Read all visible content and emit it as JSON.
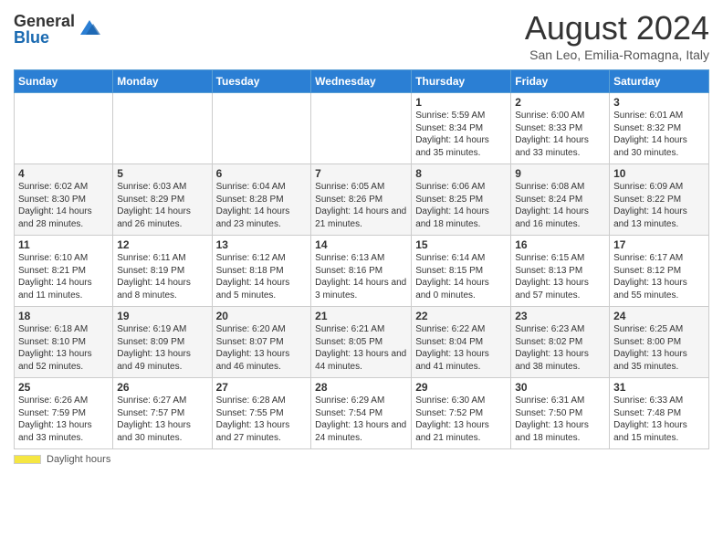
{
  "logo": {
    "general": "General",
    "blue": "Blue"
  },
  "header": {
    "title": "August 2024",
    "location": "San Leo, Emilia-Romagna, Italy"
  },
  "weekdays": [
    "Sunday",
    "Monday",
    "Tuesday",
    "Wednesday",
    "Thursday",
    "Friday",
    "Saturday"
  ],
  "weeks": [
    [
      {
        "day": "",
        "info": ""
      },
      {
        "day": "",
        "info": ""
      },
      {
        "day": "",
        "info": ""
      },
      {
        "day": "",
        "info": ""
      },
      {
        "day": "1",
        "info": "Sunrise: 5:59 AM\nSunset: 8:34 PM\nDaylight: 14 hours and 35 minutes."
      },
      {
        "day": "2",
        "info": "Sunrise: 6:00 AM\nSunset: 8:33 PM\nDaylight: 14 hours and 33 minutes."
      },
      {
        "day": "3",
        "info": "Sunrise: 6:01 AM\nSunset: 8:32 PM\nDaylight: 14 hours and 30 minutes."
      }
    ],
    [
      {
        "day": "4",
        "info": "Sunrise: 6:02 AM\nSunset: 8:30 PM\nDaylight: 14 hours and 28 minutes."
      },
      {
        "day": "5",
        "info": "Sunrise: 6:03 AM\nSunset: 8:29 PM\nDaylight: 14 hours and 26 minutes."
      },
      {
        "day": "6",
        "info": "Sunrise: 6:04 AM\nSunset: 8:28 PM\nDaylight: 14 hours and 23 minutes."
      },
      {
        "day": "7",
        "info": "Sunrise: 6:05 AM\nSunset: 8:26 PM\nDaylight: 14 hours and 21 minutes."
      },
      {
        "day": "8",
        "info": "Sunrise: 6:06 AM\nSunset: 8:25 PM\nDaylight: 14 hours and 18 minutes."
      },
      {
        "day": "9",
        "info": "Sunrise: 6:08 AM\nSunset: 8:24 PM\nDaylight: 14 hours and 16 minutes."
      },
      {
        "day": "10",
        "info": "Sunrise: 6:09 AM\nSunset: 8:22 PM\nDaylight: 14 hours and 13 minutes."
      }
    ],
    [
      {
        "day": "11",
        "info": "Sunrise: 6:10 AM\nSunset: 8:21 PM\nDaylight: 14 hours and 11 minutes."
      },
      {
        "day": "12",
        "info": "Sunrise: 6:11 AM\nSunset: 8:19 PM\nDaylight: 14 hours and 8 minutes."
      },
      {
        "day": "13",
        "info": "Sunrise: 6:12 AM\nSunset: 8:18 PM\nDaylight: 14 hours and 5 minutes."
      },
      {
        "day": "14",
        "info": "Sunrise: 6:13 AM\nSunset: 8:16 PM\nDaylight: 14 hours and 3 minutes."
      },
      {
        "day": "15",
        "info": "Sunrise: 6:14 AM\nSunset: 8:15 PM\nDaylight: 14 hours and 0 minutes."
      },
      {
        "day": "16",
        "info": "Sunrise: 6:15 AM\nSunset: 8:13 PM\nDaylight: 13 hours and 57 minutes."
      },
      {
        "day": "17",
        "info": "Sunrise: 6:17 AM\nSunset: 8:12 PM\nDaylight: 13 hours and 55 minutes."
      }
    ],
    [
      {
        "day": "18",
        "info": "Sunrise: 6:18 AM\nSunset: 8:10 PM\nDaylight: 13 hours and 52 minutes."
      },
      {
        "day": "19",
        "info": "Sunrise: 6:19 AM\nSunset: 8:09 PM\nDaylight: 13 hours and 49 minutes."
      },
      {
        "day": "20",
        "info": "Sunrise: 6:20 AM\nSunset: 8:07 PM\nDaylight: 13 hours and 46 minutes."
      },
      {
        "day": "21",
        "info": "Sunrise: 6:21 AM\nSunset: 8:05 PM\nDaylight: 13 hours and 44 minutes."
      },
      {
        "day": "22",
        "info": "Sunrise: 6:22 AM\nSunset: 8:04 PM\nDaylight: 13 hours and 41 minutes."
      },
      {
        "day": "23",
        "info": "Sunrise: 6:23 AM\nSunset: 8:02 PM\nDaylight: 13 hours and 38 minutes."
      },
      {
        "day": "24",
        "info": "Sunrise: 6:25 AM\nSunset: 8:00 PM\nDaylight: 13 hours and 35 minutes."
      }
    ],
    [
      {
        "day": "25",
        "info": "Sunrise: 6:26 AM\nSunset: 7:59 PM\nDaylight: 13 hours and 33 minutes."
      },
      {
        "day": "26",
        "info": "Sunrise: 6:27 AM\nSunset: 7:57 PM\nDaylight: 13 hours and 30 minutes."
      },
      {
        "day": "27",
        "info": "Sunrise: 6:28 AM\nSunset: 7:55 PM\nDaylight: 13 hours and 27 minutes."
      },
      {
        "day": "28",
        "info": "Sunrise: 6:29 AM\nSunset: 7:54 PM\nDaylight: 13 hours and 24 minutes."
      },
      {
        "day": "29",
        "info": "Sunrise: 6:30 AM\nSunset: 7:52 PM\nDaylight: 13 hours and 21 minutes."
      },
      {
        "day": "30",
        "info": "Sunrise: 6:31 AM\nSunset: 7:50 PM\nDaylight: 13 hours and 18 minutes."
      },
      {
        "day": "31",
        "info": "Sunrise: 6:33 AM\nSunset: 7:48 PM\nDaylight: 13 hours and 15 minutes."
      }
    ]
  ],
  "footer": {
    "daylight_label": "Daylight hours"
  }
}
